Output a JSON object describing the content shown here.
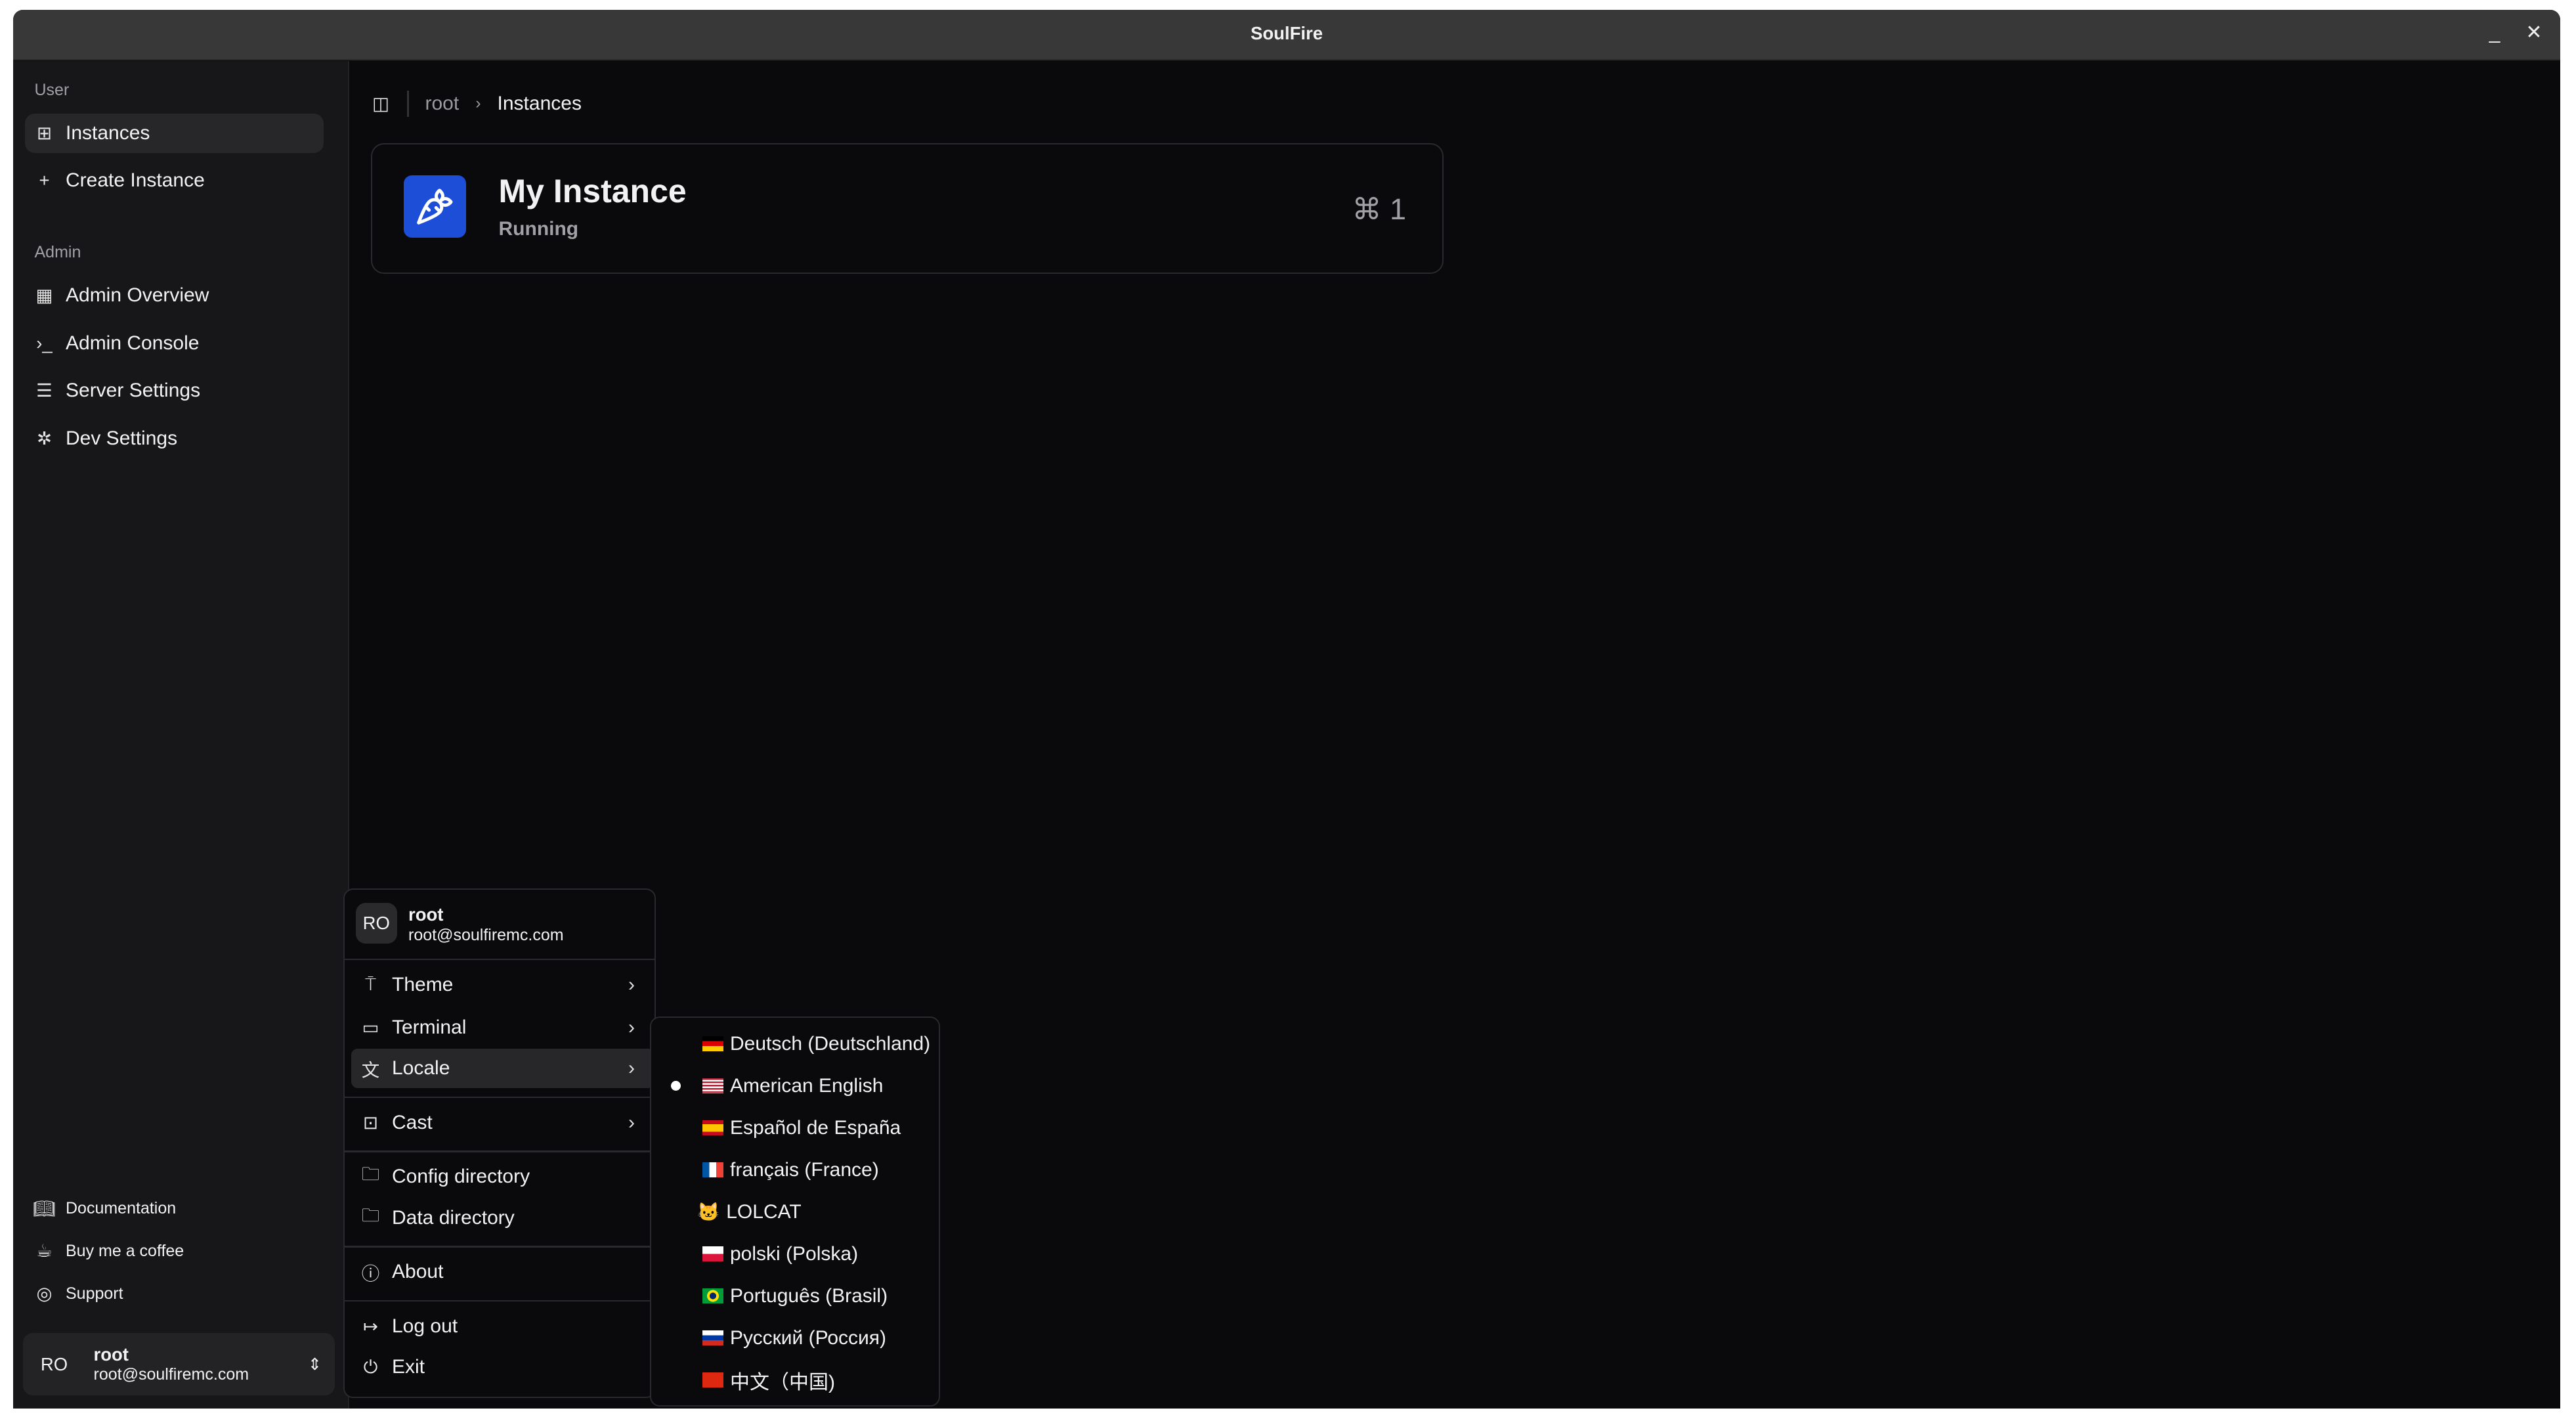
{
  "window": {
    "title": "SoulFire",
    "minimize": "_",
    "close": "✕"
  },
  "sidebar": {
    "user_section": "User",
    "user_items": [
      {
        "label": "Instances",
        "icon": "grid-icon",
        "active": true
      },
      {
        "label": "Create Instance",
        "icon": "plus-icon"
      }
    ],
    "admin_section": "Admin",
    "admin_items": [
      {
        "label": "Admin Overview",
        "icon": "dashboard-icon"
      },
      {
        "label": "Admin Console",
        "icon": "terminal-icon"
      },
      {
        "label": "Server Settings",
        "icon": "server-icon"
      },
      {
        "label": "Dev Settings",
        "icon": "bug-icon"
      }
    ],
    "footer_items": [
      {
        "label": "Documentation",
        "icon": "book-icon"
      },
      {
        "label": "Buy me a coffee",
        "icon": "coffee-icon"
      },
      {
        "label": "Support",
        "icon": "lifebuoy-icon"
      }
    ],
    "user": {
      "initials": "RO",
      "name": "root",
      "email": "root@soulfiremc.com"
    }
  },
  "breadcrumb": {
    "root": "root",
    "current": "Instances"
  },
  "instance": {
    "name": "My Instance",
    "status": "Running",
    "shortcut": "⌘ 1",
    "accent": "#1d4ed8"
  },
  "user_menu": {
    "initials": "RO",
    "name": "root",
    "email": "root@soulfiremc.com",
    "items": {
      "theme": "Theme",
      "terminal": "Terminal",
      "locale": "Locale",
      "cast": "Cast",
      "config": "Config directory",
      "data": "Data directory",
      "about": "About",
      "logout": "Log out",
      "exit": "Exit"
    }
  },
  "locales": [
    {
      "label": "Deutsch (Deutschland)",
      "flag": "de"
    },
    {
      "label": "American English",
      "flag": "us",
      "selected": true
    },
    {
      "label": "Español de España",
      "flag": "es"
    },
    {
      "label": "français (France)",
      "flag": "fr"
    },
    {
      "label": "LOLCAT",
      "flag": "🐱"
    },
    {
      "label": "polski (Polska)",
      "flag": "pl"
    },
    {
      "label": "Português (Brasil)",
      "flag": "br"
    },
    {
      "label": "Русский (Россия)",
      "flag": "ru"
    },
    {
      "label": "中文（中国)",
      "flag": "cn"
    }
  ]
}
